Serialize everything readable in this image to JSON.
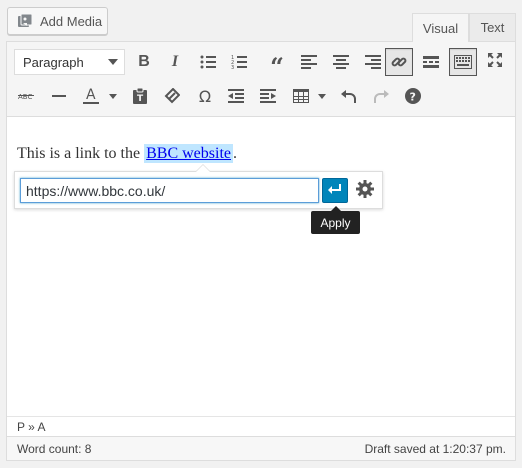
{
  "add_media": {
    "label": "Add Media",
    "icon": "media-icon"
  },
  "tabs": [
    {
      "label": "Visual",
      "active": true
    },
    {
      "label": "Text",
      "active": false
    }
  ],
  "toolbar": {
    "format_select": "Paragraph",
    "row1_icons": [
      "bold-icon",
      "italic-icon",
      "bullet-list-icon",
      "numbered-list-icon",
      "blockquote-icon",
      "align-left-icon",
      "align-center-icon",
      "align-right-icon",
      "link-icon",
      "read-more-icon",
      "toolbar-toggle-icon",
      "fullscreen-icon"
    ],
    "row2_icons": [
      "strikethrough-icon",
      "horizontal-rule-icon",
      "text-color-icon",
      "paste-text-icon",
      "clear-formatting-icon",
      "special-character-icon",
      "outdent-icon",
      "indent-icon",
      "table-icon",
      "undo-icon",
      "redo-icon",
      "help-icon"
    ]
  },
  "content": {
    "text_before": "This is a link to the ",
    "link_text": "BBC website",
    "text_after": "."
  },
  "link_popup": {
    "url": "https://www.bbc.co.uk/",
    "apply_tooltip": "Apply",
    "apply_color": "#0085ba"
  },
  "path_bar": "P » A",
  "status": {
    "word_count": "Word count: 8",
    "draft_saved": "Draft saved at 1:20:37 pm."
  }
}
